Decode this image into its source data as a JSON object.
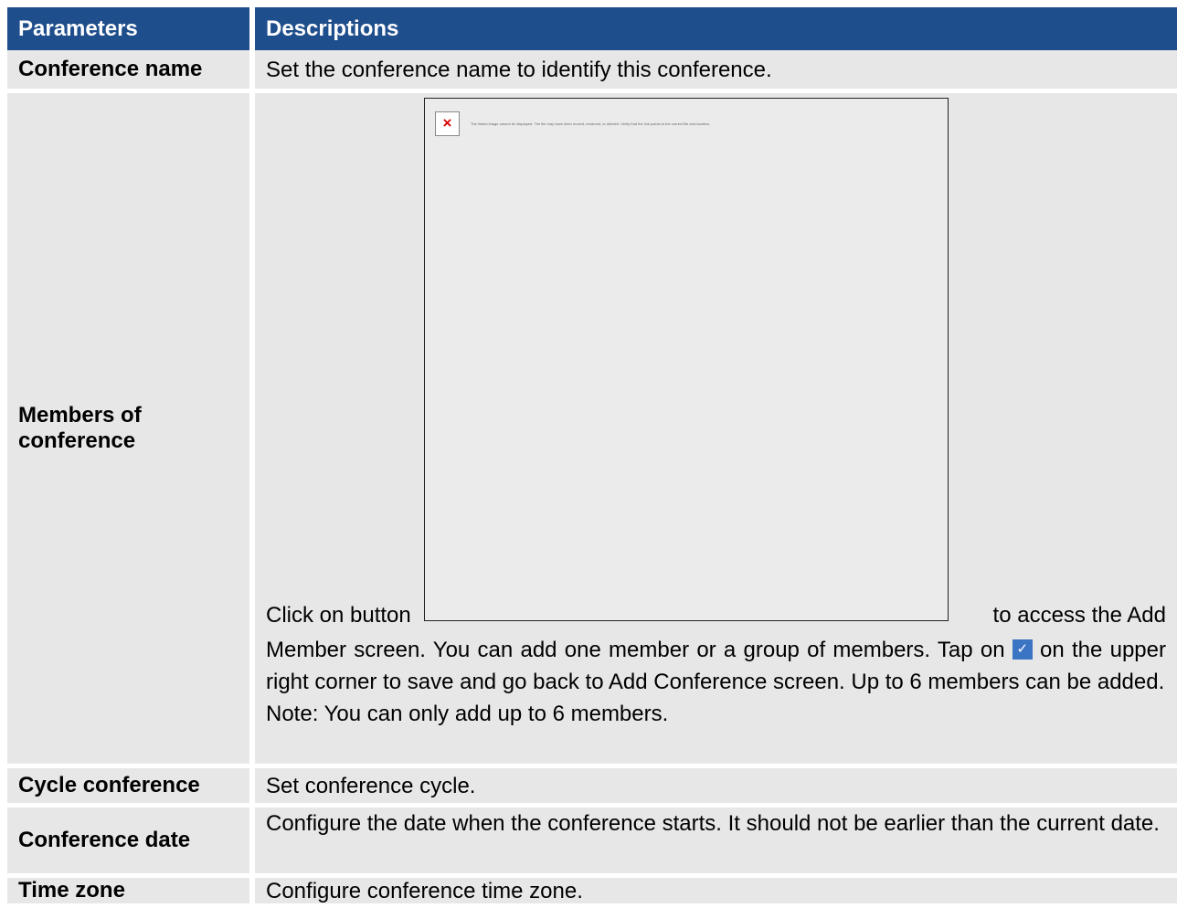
{
  "header": {
    "col1": "Parameters",
    "col2": "Descriptions"
  },
  "rows": {
    "conference_name": {
      "param": "Conference name",
      "desc": "Set the conference name to identify this conference."
    },
    "members": {
      "param": "Members of conference",
      "broken_image_msg": "The linked image cannot be displayed. The file may have been moved, renamed, or deleted. Verify that the link points to the correct file and location.",
      "click_prefix": "Click on button",
      "click_suffix": "to access the Add",
      "desc_part1": "Member screen. You can add one member or a group of members. Tap on",
      "desc_part2": "on the upper right corner to save and go back to Add Conference screen. Up to 6 members can be added.",
      "note": "Note: You can only add up to 6 members."
    },
    "cycle": {
      "param": "Cycle conference",
      "desc": "Set conference cycle."
    },
    "date": {
      "param": "Conference date",
      "desc": "Configure the date when the conference starts. It should not be earlier than the current date."
    },
    "timezone": {
      "param": "Time zone",
      "desc": "Configure conference time zone."
    }
  },
  "icons": {
    "broken_image": "broken-image-icon",
    "check": "check-icon"
  },
  "colors": {
    "header_bg": "#1f4e8c",
    "row_bg": "#e7e7e7",
    "check_bg": "#3a74c3"
  }
}
